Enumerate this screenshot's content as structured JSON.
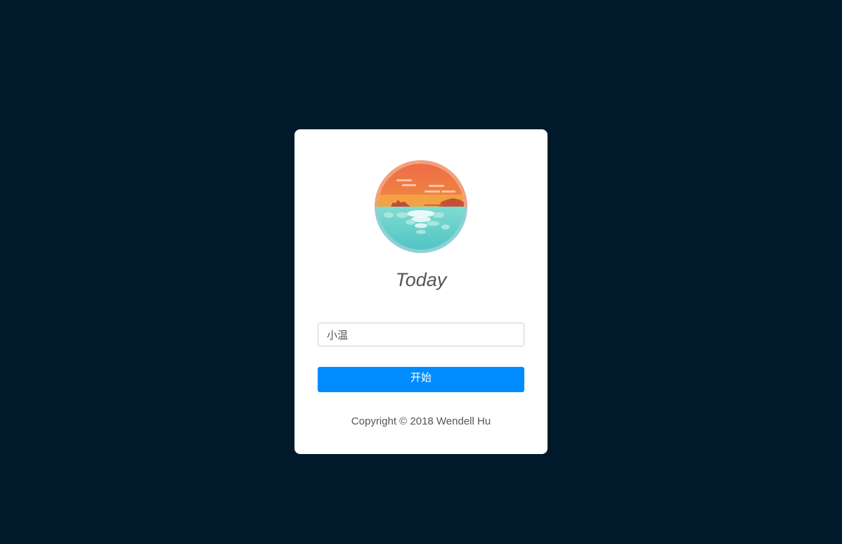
{
  "login": {
    "logo_icon": "sunset-lake-icon",
    "title": "Today",
    "name_input_value": "小温",
    "start_button_label": "开始",
    "copyright": "Copyright © 2018 Wendell Hu"
  },
  "colors": {
    "background": "#011a2b",
    "card": "#ffffff",
    "button": "#008cff",
    "text": "#555555"
  }
}
